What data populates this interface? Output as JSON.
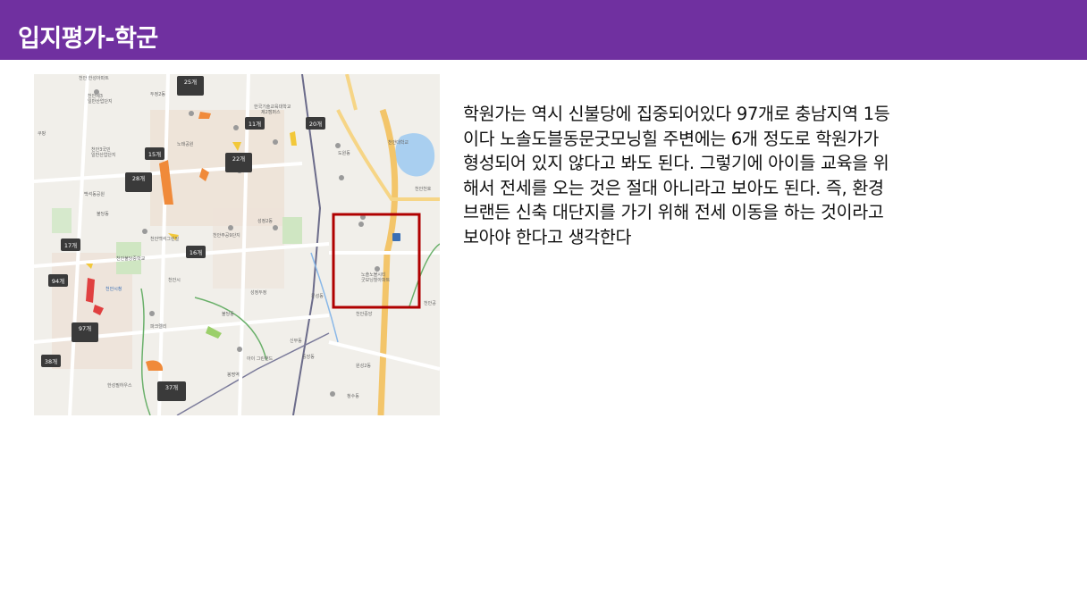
{
  "header": {
    "title": "입지평가-학군"
  },
  "map": {
    "icon": "school-district-map",
    "markers": [
      {
        "count": "25개"
      },
      {
        "count": "11개"
      },
      {
        "count": "20개"
      },
      {
        "count": "15개"
      },
      {
        "count": "22개"
      },
      {
        "count": "28개"
      },
      {
        "count": "17개"
      },
      {
        "count": "16개"
      },
      {
        "count": "94개"
      },
      {
        "count": "97개"
      },
      {
        "count": "38개"
      },
      {
        "count": "37개"
      }
    ],
    "highlight_color": "#b00000"
  },
  "content": {
    "lines": [
      "학원가는 역시 신불당에 집중되어있다 97개로 충남지역 1등",
      "이다 노솔도블동문굿모닝힐 주변에는 6개 정도로 학원가가",
      "형성되어 있지 않다고 봐도 된다. 그렇기에 아이들 교육을 위",
      "해서 전세를 오는 것은 절대 아니라고 보아도 된다. 즉, 환경",
      "브랜든 신축 대단지를 가기 위해 전세 이동을 하는 것이라고",
      "보아야 한다고 생각한다"
    ]
  },
  "colors": {
    "header_bg": "#7030a0",
    "header_text": "#ffffff"
  }
}
